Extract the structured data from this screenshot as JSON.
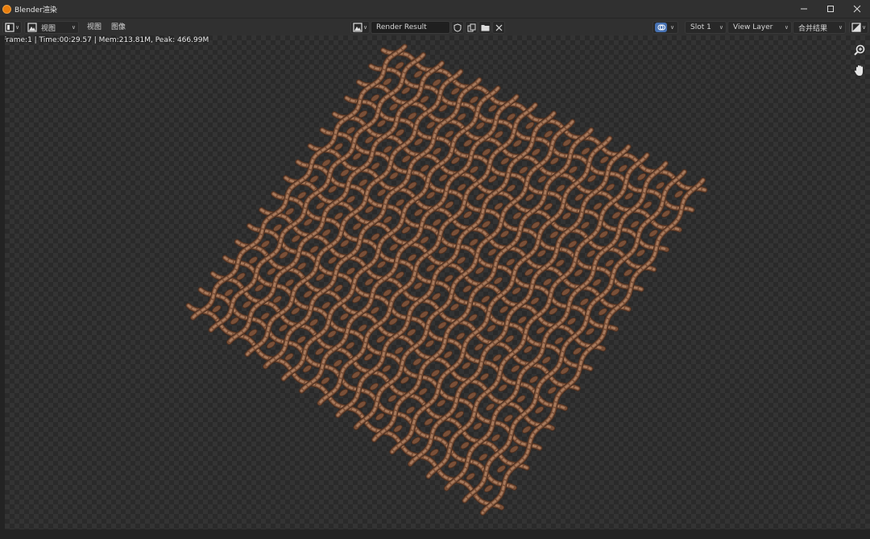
{
  "window": {
    "title": "Blender渲染",
    "controls": [
      "minimize-icon",
      "maximize-icon",
      "close-icon"
    ]
  },
  "header": {
    "editor_type_icon": "image-editor-icon",
    "mode": {
      "icon": "view-mode-icon",
      "label": "视图"
    },
    "menus": [
      "视图",
      "图像"
    ],
    "image": {
      "browse_icon": "image-browse-icon",
      "name": "Render Result"
    },
    "image_actions": [
      "fake-user-shield-icon",
      "duplicate-icon",
      "open-folder-icon",
      "close-icon"
    ],
    "display_icon": "overlay-icon",
    "slot": "Slot 1",
    "view_layer": "View Layer",
    "pass": "合并结果",
    "display_channels_icon": "display-channels-icon"
  },
  "stats": {
    "text": "Frame:1 | Time:00:29.57 | Mem:213.81M, Peak: 466.99M"
  },
  "navigation": [
    "zoom-icon",
    "pan-hand-icon"
  ],
  "render": {
    "subject": "woven rope net",
    "rope_color": "#7a5038",
    "rope_highlight": "#a87a5c",
    "rope_shadow": "#4a2e1f"
  }
}
